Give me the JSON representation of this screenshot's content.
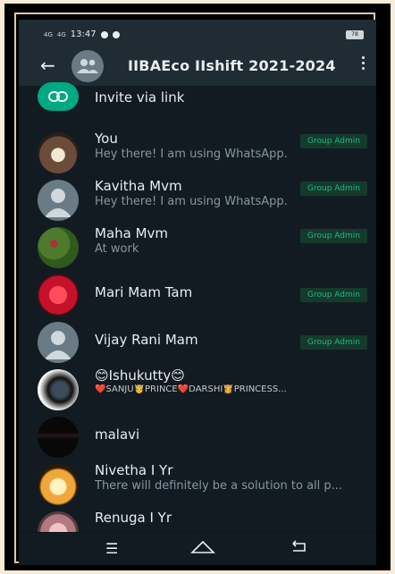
{
  "status_bar": {
    "signal1": "4G",
    "signal2": "4G",
    "time": "13:47",
    "battery": "78"
  },
  "app_bar": {
    "title": "IIBAEco IIshift 2021-2024"
  },
  "invite": {
    "label": "Invite via link"
  },
  "participants": [
    {
      "name": "You",
      "status": "Hey there! I am using WhatsApp.",
      "admin": "Group Admin"
    },
    {
      "name": "Kavitha Mvm",
      "status": "Hey there! I am using WhatsApp.",
      "admin": "Group Admin"
    },
    {
      "name": "Maha Mvm",
      "status": "At work",
      "admin": "Group Admin"
    },
    {
      "name": "Mari Mam Tam",
      "status": "",
      "admin": "Group Admin"
    },
    {
      "name": "Vijay Rani Mam",
      "status": "",
      "admin": "Group Admin"
    },
    {
      "name": "😊Ishukutty😊",
      "status": "❤️SANJU🤴PRINCE❤️DARSHI👸PRINCESS..."
    },
    {
      "name": "malavi",
      "status": ""
    },
    {
      "name": "Nivetha I Yr",
      "status": "There will definitely be a solution to all p..."
    },
    {
      "name": "Renuga I Yr",
      "status": ""
    }
  ],
  "colors": {
    "background": "#121b22",
    "accent": "#00a884",
    "badge_text": "#1fb884",
    "secondary_text": "#8696a0"
  },
  "icons": {
    "back": "arrow-left-icon",
    "menu": "more-vert-icon",
    "invite": "link-icon",
    "default_avatar": "person-icon",
    "group_avatar": "group-icon"
  }
}
